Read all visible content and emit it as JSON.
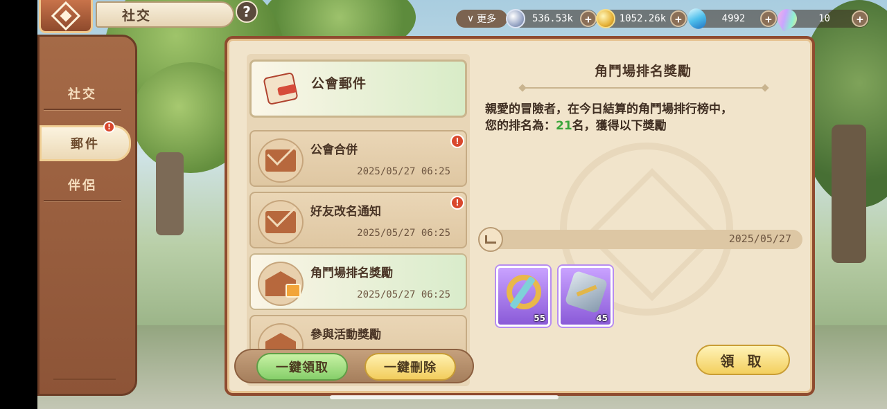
{
  "nav": {
    "title": "社交",
    "help_label": "?"
  },
  "currencies": {
    "more_label": "更多",
    "silver": "536.53k",
    "gold": "1052.26k",
    "gem": "4992",
    "rainbow": "10",
    "plus": "+"
  },
  "sidebar": {
    "items": [
      {
        "label": "社交"
      },
      {
        "label": "郵件",
        "badge": "!"
      },
      {
        "label": "伴侶"
      }
    ]
  },
  "mail_list": {
    "header": "公會郵件",
    "items": [
      {
        "subject": "公會合併",
        "date": "2025/05/27  06:25",
        "badge": "!"
      },
      {
        "subject": "好友改名通知",
        "date": "2025/05/27  06:25",
        "badge": "!"
      },
      {
        "subject": "角鬥場排名獎勵",
        "date": "2025/05/27  06:25"
      },
      {
        "subject": "參與活動獎勵"
      }
    ],
    "claim_all": "一鍵領取",
    "delete_all": "一鍵刪除"
  },
  "detail": {
    "title": "角鬥場排名獎勵",
    "body_line1": "親愛的冒險者，在今日結算的角鬥場排行榜中，",
    "body_line2_prefix": "您的排名為：",
    "rank": "21",
    "body_line2_suffix": "名，獲得以下獎勵",
    "date": "2025/05/27",
    "rewards": [
      {
        "icon": "ring-sword-icon",
        "qty": "55"
      },
      {
        "icon": "hammer-stone-icon",
        "qty": "45"
      }
    ],
    "claim_label": "領 取"
  },
  "colors": {
    "accent_green": "#3aa53a",
    "frame_brown": "#8f4b2f",
    "badge_red": "#d9482d"
  }
}
